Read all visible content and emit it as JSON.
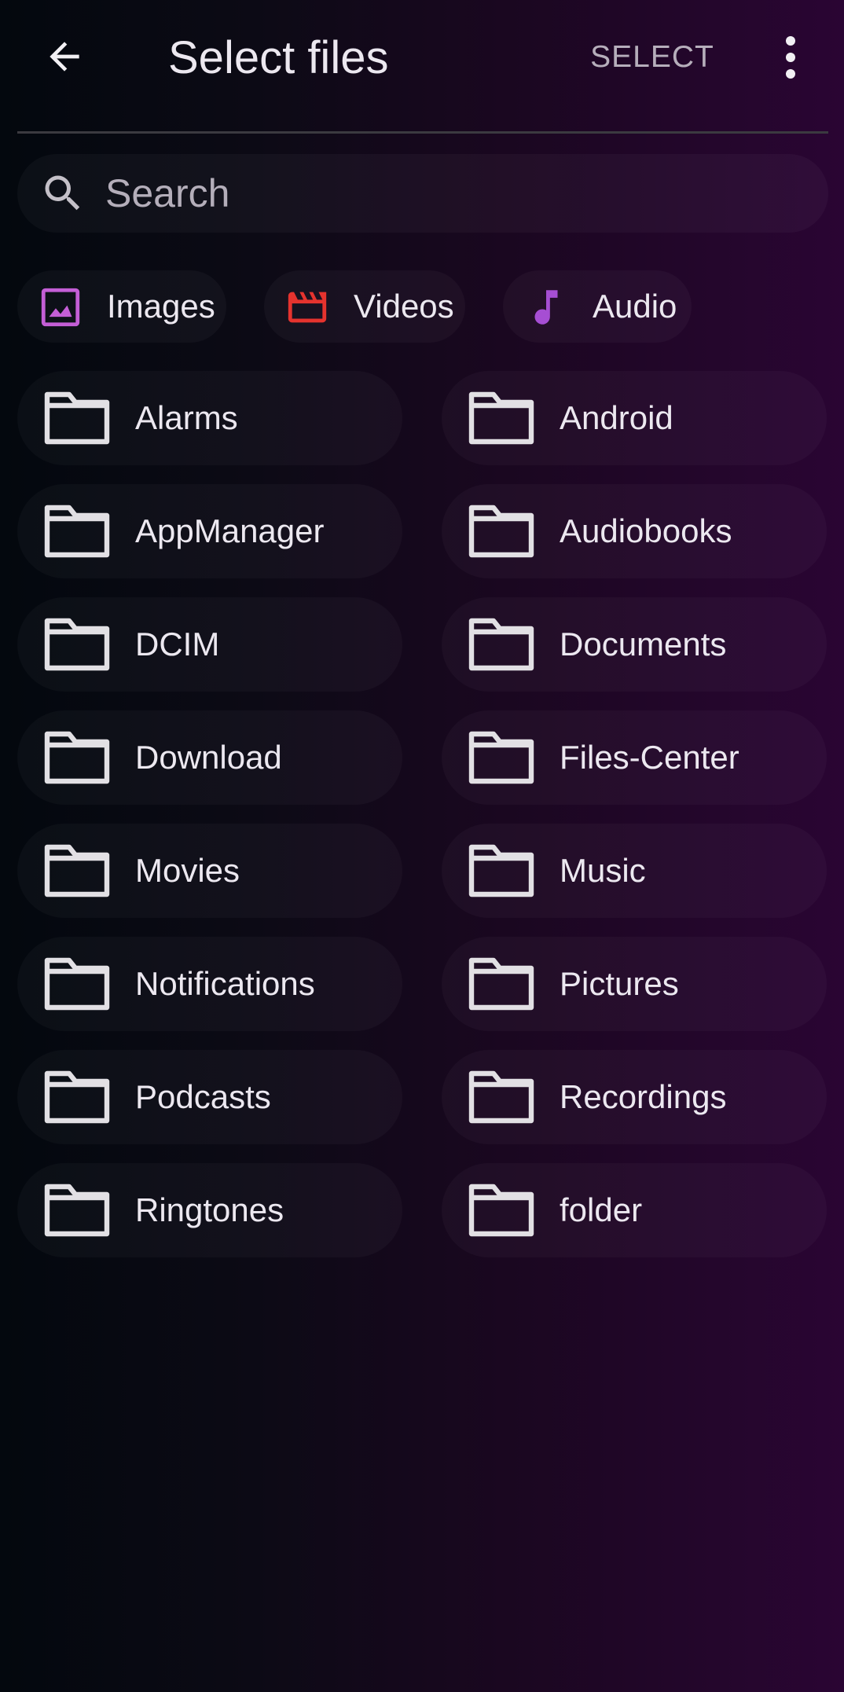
{
  "app_bar": {
    "title": "Select files",
    "select_label": "SELECT",
    "back_icon": "arrow-back-icon",
    "more_icon": "more-vert-icon"
  },
  "search": {
    "placeholder": "Search",
    "value": "",
    "icon": "search-icon"
  },
  "filters": [
    {
      "label": "Images",
      "icon": "image-icon",
      "color": "#c45ed6"
    },
    {
      "label": "Videos",
      "icon": "movie-clapper-icon",
      "color": "#e5332e"
    },
    {
      "label": "Audio",
      "icon": "music-note-icon",
      "color": "#a64ed3"
    }
  ],
  "folders": [
    {
      "label": "Alarms"
    },
    {
      "label": "Android"
    },
    {
      "label": "AppManager"
    },
    {
      "label": "Audiobooks"
    },
    {
      "label": "DCIM"
    },
    {
      "label": "Documents"
    },
    {
      "label": "Download"
    },
    {
      "label": "Files-Center"
    },
    {
      "label": "Movies"
    },
    {
      "label": "Music"
    },
    {
      "label": "Notifications"
    },
    {
      "label": "Pictures"
    },
    {
      "label": "Podcasts"
    },
    {
      "label": "Recordings"
    },
    {
      "label": "Ringtones"
    },
    {
      "label": "folder"
    }
  ],
  "colors": {
    "text": "#ece8f0",
    "muted": "#b6aebb",
    "folder_icon": "#e2e0e4"
  }
}
